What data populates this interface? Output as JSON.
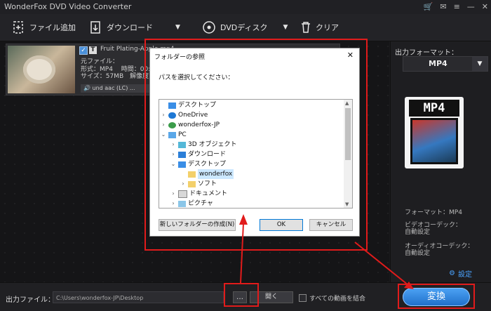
{
  "window": {
    "title": "WonderFox DVD Video Converter"
  },
  "toolbar": {
    "add_file": "ファイル追加",
    "download": "ダウンロード",
    "dvd_disc": "DVDディスク",
    "clear": "クリア"
  },
  "file": {
    "name": "Fruit Plating-Apple.mp4",
    "source_label": "元ファイル：",
    "format_line": "形式：MP4　 時間：00:",
    "size_line": "サイズ：57MB　解像度：",
    "audio": "und aac (LC) ..."
  },
  "output": {
    "label": "出力フォーマット：",
    "format": "MP4",
    "format_info": "フォーマット：MP4",
    "video_codec_label": "ビデオコーデック：",
    "video_codec": "自動設定",
    "audio_codec_label": "オーディオコーデック：",
    "audio_codec": "自動設定",
    "settings": "設定"
  },
  "bottom": {
    "output_file_label": "出力ファイル：",
    "path": "C:\\Users\\wonderfox-JP\\Desktop",
    "browse": "…",
    "open": "開く",
    "merge": "すべての動画を結合",
    "convert": "変換"
  },
  "dialog": {
    "title": "フォルダーの参照",
    "close": "✕",
    "prompt": "パスを選択してください：",
    "tree": [
      {
        "label": "デスクトップ",
        "icon": "desktop-icon"
      },
      {
        "label": "OneDrive",
        "icon": "cloud-icon"
      },
      {
        "label": "wonderfox-JP",
        "icon": "user-icon"
      },
      {
        "label": "PC",
        "icon": "pc-icon"
      },
      {
        "label": "3D オブジェクト",
        "icon": "cube-icon"
      },
      {
        "label": "ダウンロード",
        "icon": "download-icon"
      },
      {
        "label": "デスクトップ",
        "icon": "desktop-icon"
      },
      {
        "label": "wonderfox",
        "icon": "folder-icon"
      },
      {
        "label": "ソフト",
        "icon": "folder-icon"
      },
      {
        "label": "ドキュメント",
        "icon": "document-icon"
      },
      {
        "label": "ピクチャ",
        "icon": "picture-icon"
      }
    ],
    "new_folder": "新しいフォルダーの作成(N)",
    "ok": "OK",
    "cancel": "キャンセル"
  },
  "colors": {
    "accent": "#1f6fc9",
    "highlight": "#e11b1b"
  }
}
